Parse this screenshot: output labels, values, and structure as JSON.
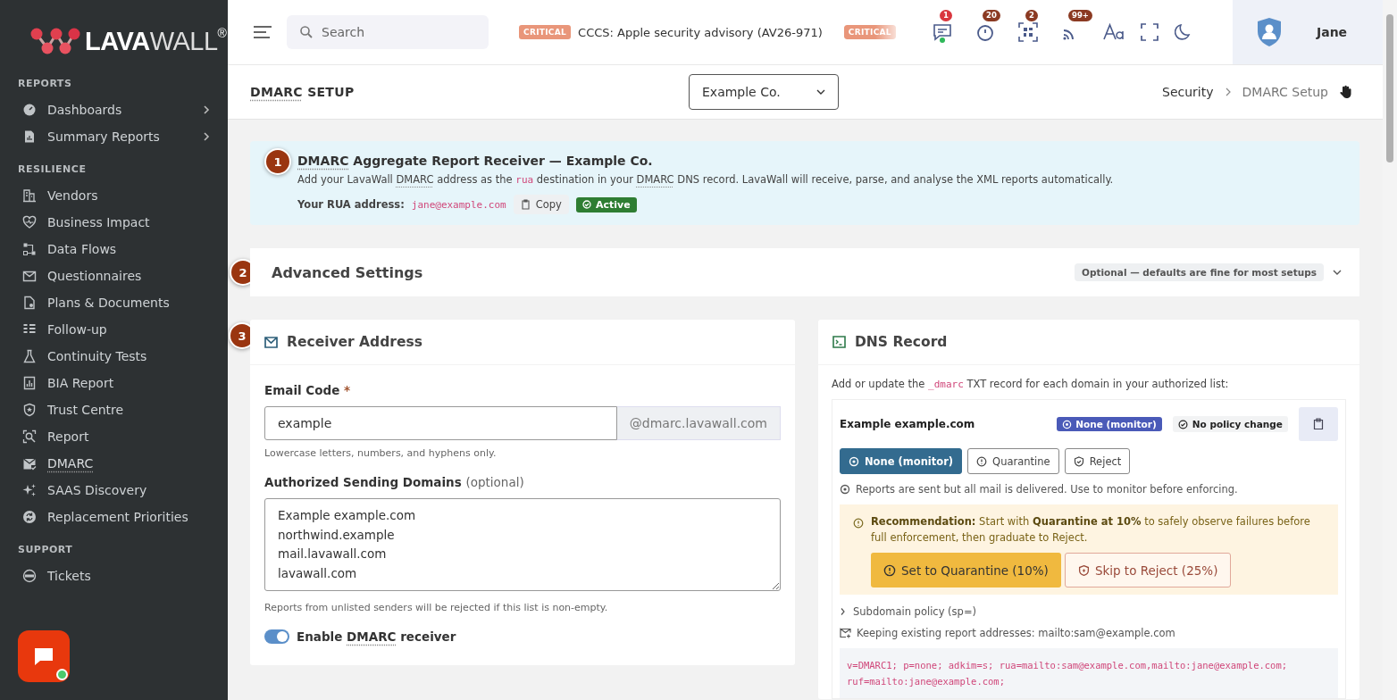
{
  "brand": {
    "bold": "LAVA",
    "light": "WALL",
    "mark": "®"
  },
  "sidebar": {
    "sections": [
      {
        "heading": "REPORTS",
        "items": [
          {
            "label": "Dashboards",
            "has_submenu": true,
            "selected": false
          },
          {
            "label": "Summary Reports",
            "has_submenu": true,
            "selected": false
          }
        ]
      },
      {
        "heading": "RESILIENCE",
        "items": [
          {
            "label": "Vendors",
            "has_submenu": false,
            "selected": false
          },
          {
            "label": "Business Impact",
            "has_submenu": false,
            "selected": false
          },
          {
            "label": "Data Flows",
            "has_submenu": false,
            "selected": false
          },
          {
            "label": "Questionnaires",
            "has_submenu": false,
            "selected": false
          },
          {
            "label": "Plans & Documents",
            "has_submenu": false,
            "selected": false
          },
          {
            "label": "Follow-up",
            "has_submenu": false,
            "selected": false
          },
          {
            "label": "Continuity Tests",
            "has_submenu": false,
            "selected": false
          },
          {
            "label": "BIA Report",
            "has_submenu": false,
            "selected": false
          },
          {
            "label": "Trust Centre",
            "has_submenu": false,
            "selected": false
          },
          {
            "label": "Report",
            "has_submenu": false,
            "selected": false
          },
          {
            "label": "DMARC",
            "has_submenu": false,
            "selected": true
          },
          {
            "label": "SAAS Discovery",
            "has_submenu": false,
            "selected": false
          },
          {
            "label": "Replacement Priorities",
            "has_submenu": false,
            "selected": false
          }
        ]
      },
      {
        "heading": "SUPPORT",
        "items": [
          {
            "label": "Tickets",
            "has_submenu": false,
            "selected": false
          }
        ]
      }
    ]
  },
  "topbar": {
    "search": {
      "placeholder": "Search"
    },
    "ticker": [
      {
        "tag": "CRITICAL",
        "text": "CCCS: Apple security advisory (AV26-971)",
        "faded": false
      },
      {
        "tag": "CRITICAL",
        "faded": true
      }
    ],
    "badges": [
      "1",
      "20",
      "2",
      "99+"
    ],
    "user": "Jane"
  },
  "page_header": {
    "title_abbr": "DMARC",
    "title_rest": "SETUP",
    "company": "Example Co.",
    "breadcrumb": [
      "Security",
      "DMARC Setup"
    ]
  },
  "info_banner": {
    "step": "1",
    "title_abbr": "DMARC",
    "title_rest": "Aggregate Report Receiver — Example Co.",
    "description": [
      {
        "kind": "text",
        "text": "Add your LavaWall "
      },
      {
        "kind": "abbr",
        "text": "DMARC"
      },
      {
        "kind": "text",
        "text": " address as the "
      },
      {
        "kind": "code",
        "text": "rua"
      },
      {
        "kind": "text",
        "text": " destination in your "
      },
      {
        "kind": "abbr",
        "text": "DMARC"
      },
      {
        "kind": "text",
        "text": " DNS record. LavaWall will receive, parse, and analyse the XML reports automatically."
      }
    ],
    "rua_label": "Your RUA address:",
    "rua_value": "jane@example.com",
    "copy": "Copy",
    "status": "Active"
  },
  "advanced": {
    "step": "2",
    "title": "Advanced Settings",
    "hint": "Optional — defaults are fine for most setups",
    "expanded": false
  },
  "receiver": {
    "step": "3",
    "title": "Receiver Address",
    "email_label": "Email Code",
    "required": "*",
    "email_value": "example",
    "email_suffix": "@dmarc.lavawall.com",
    "email_help": "Lowercase letters, numbers, and hyphens only.",
    "domains_label": "Authorized Sending Domains",
    "domains_optional": "(optional)",
    "domains": [
      "Example example.com",
      "northwind.example",
      "mail.lavawall.com",
      "lavawall.com"
    ],
    "domains_help": "Reports from unlisted senders will be rejected if this list is non-empty.",
    "enable": {
      "on": true,
      "label_before": "Enable",
      "label_abbr": "DMARC",
      "label_after": "receiver"
    }
  },
  "dns": {
    "title": "DNS Record",
    "intro": [
      {
        "kind": "text",
        "text": "Add or update the "
      },
      {
        "kind": "code",
        "text": "_dmarc"
      },
      {
        "kind": "text",
        "text": " TXT record for each domain in your authorized list:"
      }
    ],
    "domain": "Example example.com",
    "policy_badge": "None (monitor)",
    "change_badge": "No policy change",
    "policies": [
      {
        "label": "None (monitor)",
        "selected": true
      },
      {
        "label": "Quarantine",
        "selected": false
      },
      {
        "label": "Reject",
        "selected": false
      }
    ],
    "policy_note": "Reports are sent but all mail is delivered. Use to monitor before enforcing.",
    "recommendation": "**Recommendation:** Start with **Quarantine at 10%** to safely observe failures before full enforcement, then graduate to Reject.",
    "primary_action": "Set to Quarantine (10%)",
    "secondary_action": "Skip to Reject (25%)",
    "subdomain": {
      "label": "Subdomain policy (sp=)",
      "expanded": false
    },
    "keeping": "Keeping existing report addresses: mailto:sam@example.com",
    "record": "v=DMARC1; p=none; adkim=s; rua=mailto:sam@example.com,mailto:jane@example.com; ruf=mailto:jane@example.com;"
  }
}
